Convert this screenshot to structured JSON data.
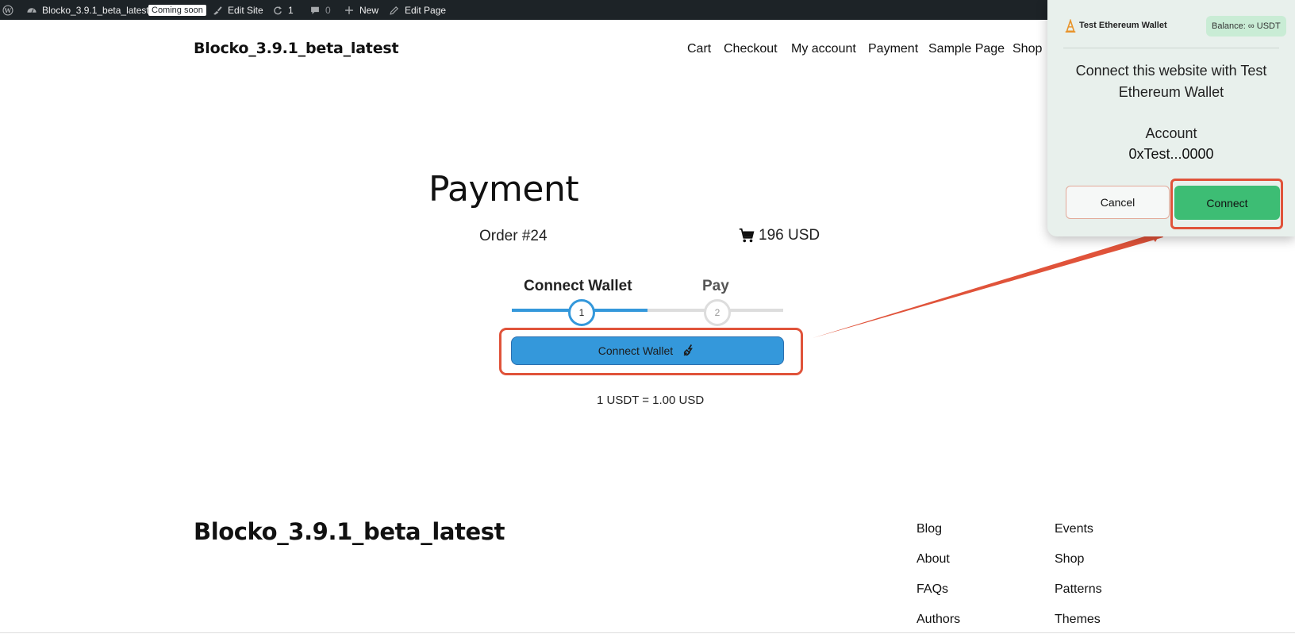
{
  "admin_bar": {
    "site_name": "Blocko_3.9.1_beta_latest",
    "coming_soon": "Coming soon",
    "edit_site": "Edit Site",
    "updates_count": "1",
    "comments_count": "0",
    "new_label": "New",
    "edit_page": "Edit Page"
  },
  "header": {
    "site_title": "Blocko_3.9.1_beta_latest",
    "nav": [
      "Cart",
      "Checkout",
      "My account",
      "Payment",
      "Sample Page",
      "Shop"
    ]
  },
  "payment": {
    "title": "Payment",
    "order": "Order #24",
    "amount": "196 USD",
    "steps": [
      {
        "label": "Connect Wallet",
        "number": "1"
      },
      {
        "label": "Pay",
        "number": "2"
      }
    ],
    "connect_button": "Connect Wallet",
    "rate": "1 USDT = 1.00 USD"
  },
  "footer": {
    "site_title": "Blocko_3.9.1_beta_latest",
    "col1": [
      "Blog",
      "About",
      "FAQs",
      "Authors"
    ],
    "col2": [
      "Events",
      "Shop",
      "Patterns",
      "Themes"
    ]
  },
  "wallet_popup": {
    "name": "Test Ethereum Wallet",
    "balance": "Balance: ∞ USDT",
    "message": "Connect this website with Test Ethereum Wallet",
    "account_label": "Account",
    "account": "0xTest...0000",
    "cancel": "Cancel",
    "connect": "Connect"
  },
  "colors": {
    "admin_bar": "#1d2327",
    "accent_blue": "#3498db",
    "annotation_red": "#e0533a",
    "connect_green": "#3dbd74",
    "popup_bg": "#e8f0ec"
  }
}
